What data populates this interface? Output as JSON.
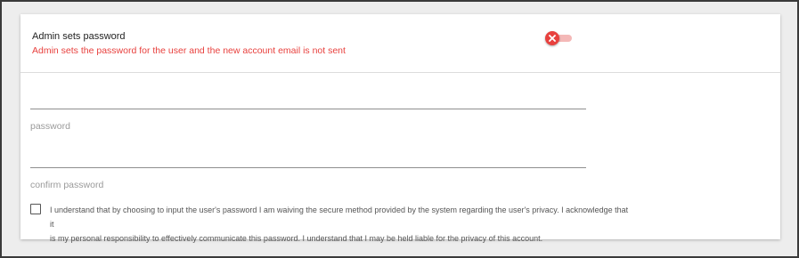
{
  "setting": {
    "title": "Admin sets password",
    "description": "Admin sets the password for the user and the new account email is not sent",
    "toggle_state": "off",
    "toggle_icon": "close-x-icon"
  },
  "fields": {
    "password_label": "password",
    "confirm_password_label": "confirm password"
  },
  "acknowledgement": {
    "text_line1": "I understand that by choosing to input the user's password I am waiving the secure method provided by the system regarding the user's privacy. I acknowledge that it",
    "text_line2": "is my personal responsibility to effectively communicate this password. I understand that I may be held liable for the privacy of this account.",
    "checked": false
  },
  "colors": {
    "accent_red": "#e8413e",
    "track_pink": "#f4b8b7"
  }
}
